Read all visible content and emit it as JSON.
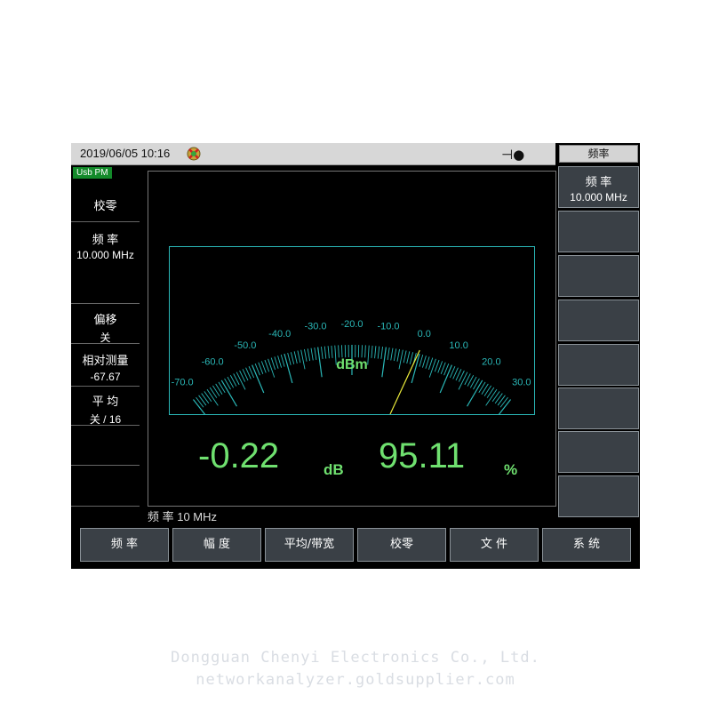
{
  "titlebar": {
    "datetime": "2019/06/05 10:16"
  },
  "badge": "Usb PM",
  "left_panel": {
    "zero": "校零",
    "freq_label": "频 率",
    "freq_value": "10.000 MHz",
    "offset_label": "偏移",
    "offset_value": "关",
    "relative_label": "相对测量",
    "relative_value": "-67.67",
    "avg_label": "平 均",
    "avg_value": "关 / 16"
  },
  "meter": {
    "unit": "dBm",
    "scale_labels": [
      "-70.0",
      "-60.0",
      "-50.0",
      "-40.0",
      "-30.0",
      "-20.0",
      "-10.0",
      "0.0",
      "10.0",
      "20.0",
      "30.0"
    ],
    "needle_value_dbm": -0.22,
    "scale_min": -70,
    "scale_max": 30
  },
  "readout": {
    "value1": "-0.22",
    "unit1": "dB",
    "value2": "95.11",
    "unit2": "%"
  },
  "footer": {
    "freq": "频 率 10 MHz"
  },
  "softkeys": {
    "title": "频率",
    "key1_label": "频 率",
    "key1_value": "10.000 MHz"
  },
  "bottom_menu": {
    "b1": "频 率",
    "b2": "幅 度",
    "b3": "平均/带宽",
    "b4": "校零",
    "b5": "文 件",
    "b6": "系 统"
  },
  "watermark": {
    "line1": "Dongguan Chenyi Electronics Co., Ltd.",
    "line2": "networkanalyzer.goldsupplier.com"
  },
  "colors": {
    "readout": "#6fe06f",
    "scale": "#2ab7b7",
    "needle": "#e8e83a",
    "badge": "#138a2a"
  }
}
